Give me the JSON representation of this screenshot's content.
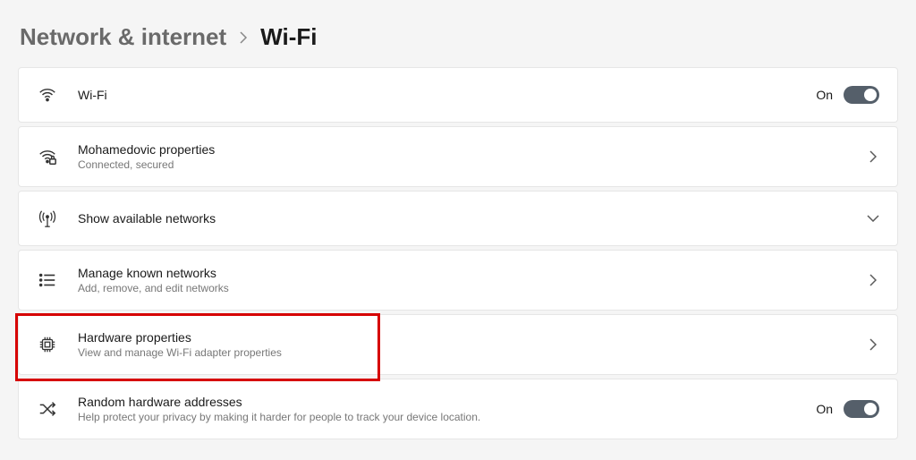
{
  "breadcrumb": {
    "parent": "Network & internet",
    "current": "Wi-Fi"
  },
  "items": {
    "wifi": {
      "title": "Wi-Fi",
      "state": "On"
    },
    "network": {
      "title": "Mohamedovic properties",
      "subtitle": "Connected, secured"
    },
    "available": {
      "title": "Show available networks"
    },
    "known": {
      "title": "Manage known networks",
      "subtitle": "Add, remove, and edit networks"
    },
    "hardware": {
      "title": "Hardware properties",
      "subtitle": "View and manage Wi-Fi adapter properties"
    },
    "random": {
      "title": "Random hardware addresses",
      "subtitle": "Help protect your privacy by making it harder for people to track your device location.",
      "state": "On"
    }
  }
}
